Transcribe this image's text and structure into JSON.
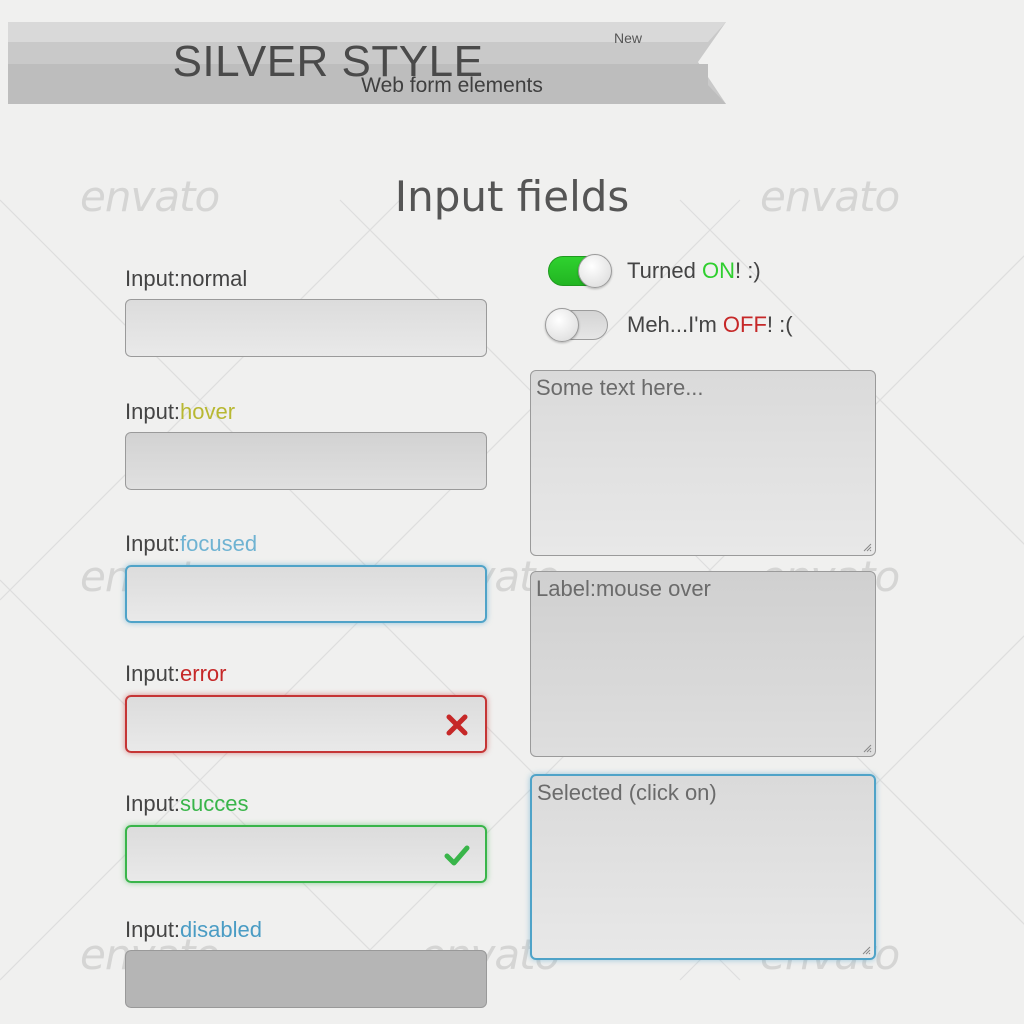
{
  "banner": {
    "title": "SILVER STYLE",
    "badge": "New",
    "subtitle": "Web form elements"
  },
  "watermark": "envato",
  "section_title": "Input fields",
  "inputs": [
    {
      "prefix": "Input:",
      "state": "normal",
      "state_color": "#444444",
      "status_icon": null
    },
    {
      "prefix": "Input:",
      "state": "hover",
      "state_color": "#b8b832",
      "status_icon": null
    },
    {
      "prefix": "Input:",
      "state": "focused",
      "state_color": "#6fb3d2",
      "status_icon": null
    },
    {
      "prefix": "Input:",
      "state": "error",
      "state_color": "#c62828",
      "status_icon": "x-icon"
    },
    {
      "prefix": "Input:",
      "state": "succes",
      "state_color": "#39b54a",
      "status_icon": "checkmark-icon"
    },
    {
      "prefix": "Input:",
      "state": "disabled",
      "state_color": "#4a9cc4",
      "status_icon": null
    }
  ],
  "toggles": [
    {
      "state": "on",
      "label_before": "Turned ",
      "label_status": "ON",
      "label_after": "! :)"
    },
    {
      "state": "off",
      "label_before": "Meh...I'm ",
      "label_status": "OFF",
      "label_after": "! :("
    }
  ],
  "textareas": [
    {
      "placeholder": "Some text here...",
      "state": "normal"
    },
    {
      "placeholder": "Label:mouse over",
      "state": "hover"
    },
    {
      "placeholder": "Selected (click on)",
      "state": "selected"
    }
  ],
  "colors": {
    "focus": "#4fa3c8",
    "error": "#c53535",
    "success": "#39b54a",
    "toggle_on": "#2fd22f"
  }
}
